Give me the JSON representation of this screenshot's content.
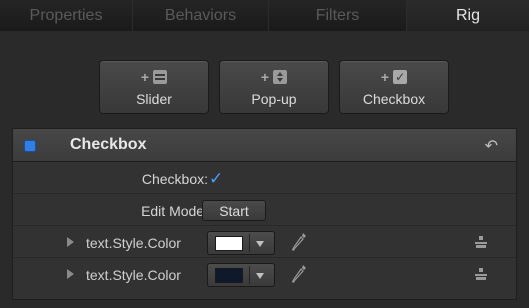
{
  "tabs": [
    {
      "label": "Properties",
      "active": false
    },
    {
      "label": "Behaviors",
      "active": false
    },
    {
      "label": "Filters",
      "active": false
    },
    {
      "label": "Rig",
      "active": true
    }
  ],
  "add_buttons": [
    {
      "label": "Slider",
      "plus": "+",
      "icon": "slider-icon"
    },
    {
      "label": "Pop-up",
      "plus": "+",
      "icon": "popup-icon"
    },
    {
      "label": "Checkbox",
      "plus": "+",
      "icon": "checkbox-icon"
    }
  ],
  "widget": {
    "title": "Checkbox",
    "enabled_color": "#2f7fe6",
    "reset_icon": "reset-icon",
    "checkbox_label": "Checkbox:",
    "checkbox_checked": true,
    "checkmark_glyph": "✓",
    "edit_mode_label": "Edit Mode:",
    "edit_mode_button": "Start",
    "parameters": [
      {
        "label": "text.Style.Color",
        "color": "#ffffff"
      },
      {
        "label": "text.Style.Color",
        "color": "#0e1a2b"
      }
    ]
  },
  "colors": {
    "accent": "#4a9cff",
    "background": "#2a2a2a"
  }
}
